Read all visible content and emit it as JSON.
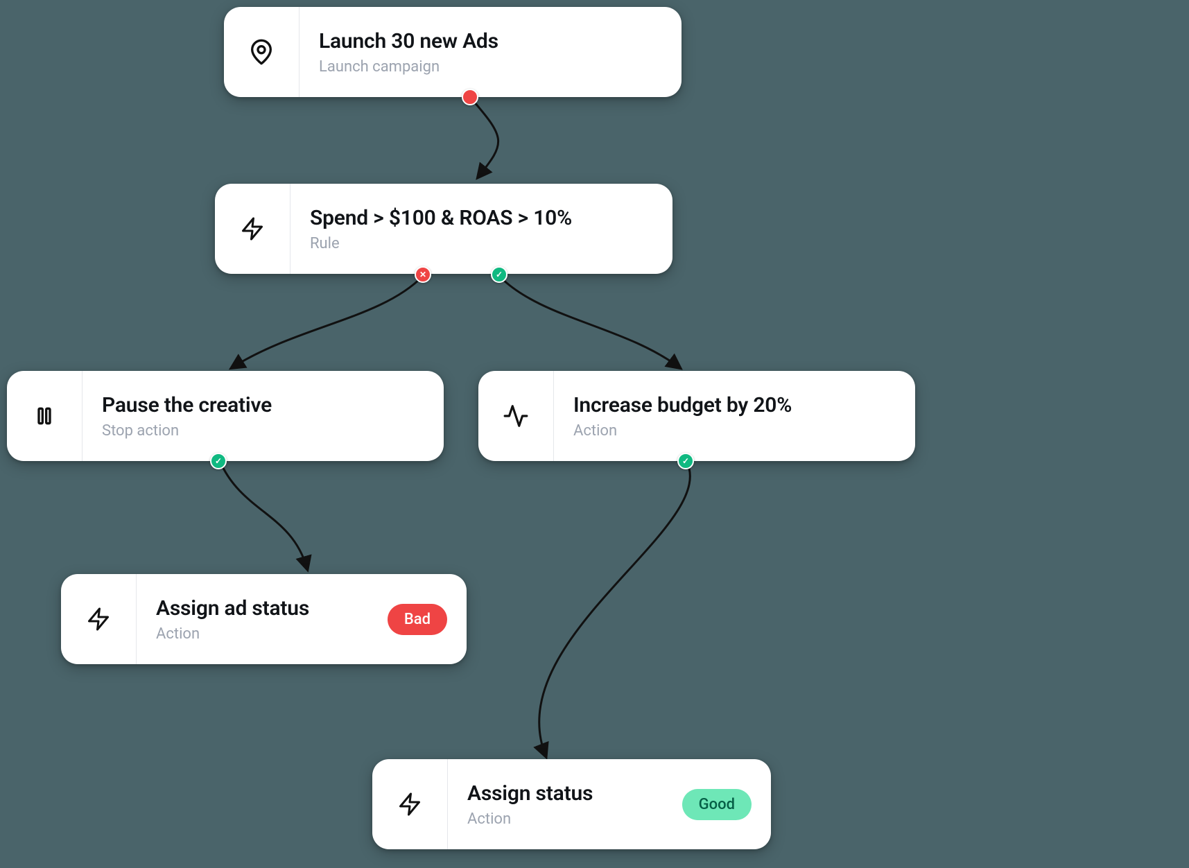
{
  "colors": {
    "bg": "#4a646a",
    "card": "#ffffff",
    "title": "#111418",
    "subtitle": "#9ca3af",
    "divider": "#e5e7eb",
    "red": "#ef4444",
    "green": "#10b981",
    "badgeGood": "#6ee7b7"
  },
  "nodes": {
    "launch": {
      "title": "Launch 30 new Ads",
      "subtitle": "Launch campaign",
      "icon": "map-pin"
    },
    "rule": {
      "title": "Spend > $100 & ROAS > 10%",
      "subtitle": "Rule",
      "icon": "bolt"
    },
    "pause": {
      "title": "Pause the creative",
      "subtitle": "Stop action",
      "icon": "pause"
    },
    "increase": {
      "title": "Increase budget by 20%",
      "subtitle": "Action",
      "icon": "activity"
    },
    "assignBad": {
      "title": "Assign ad status",
      "subtitle": "Action",
      "icon": "bolt",
      "badge": {
        "label": "Bad",
        "color": "#ef4444"
      }
    },
    "assignGood": {
      "title": "Assign status",
      "subtitle": "Action",
      "icon": "bolt",
      "badge": {
        "label": "Good",
        "color": "#6ee7b7"
      }
    }
  },
  "connectors": [
    {
      "from": "launch",
      "to": "rule",
      "fromDot": "red"
    },
    {
      "from": "rule",
      "to": "pause",
      "fromDot": "red-x"
    },
    {
      "from": "rule",
      "to": "increase",
      "fromDot": "green-check"
    },
    {
      "from": "pause",
      "to": "assignBad",
      "fromDot": "green-check"
    },
    {
      "from": "increase",
      "to": "assignGood",
      "fromDot": "green-check"
    }
  ]
}
